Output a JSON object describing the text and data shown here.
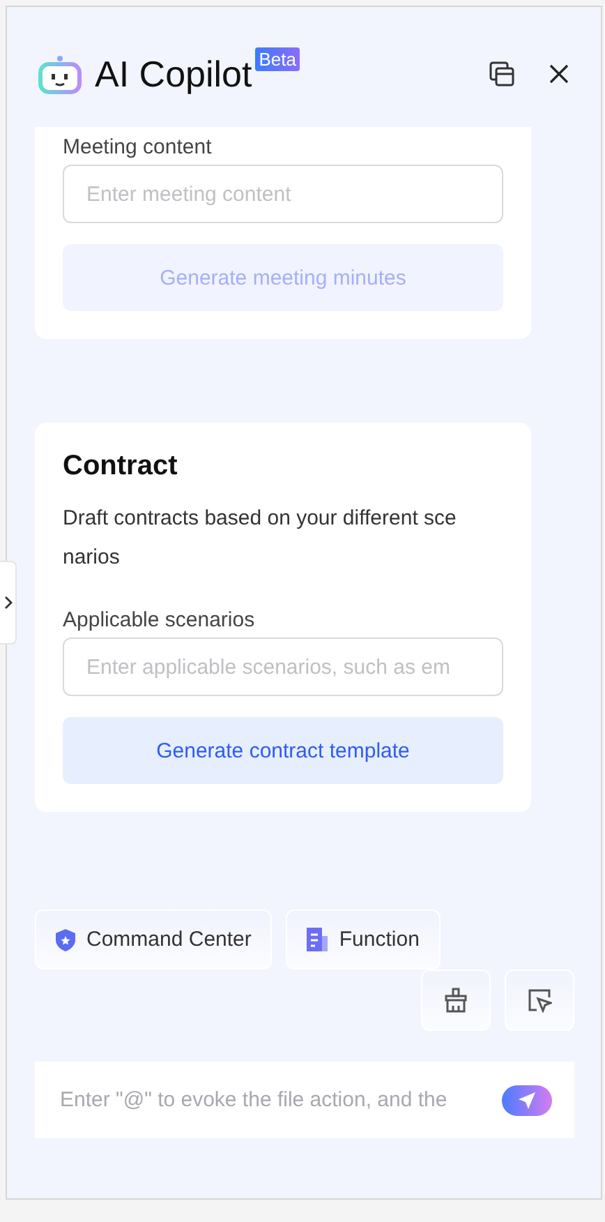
{
  "header": {
    "title": "AI Copilot",
    "badge": "Beta"
  },
  "cards": [
    {
      "field_label": "Meeting content",
      "placeholder": "Enter meeting content",
      "button": {
        "label": "Generate meeting minutes",
        "disabled": true
      }
    },
    {
      "title": "Contract",
      "description": "Draft contracts based on your different scenarios",
      "field_label": "Applicable scenarios",
      "placeholder": "Enter applicable scenarios, such as em",
      "button": {
        "label": "Generate contract template",
        "disabled": false
      }
    }
  ],
  "chips": [
    {
      "kind": "shield",
      "label": "Command Center"
    },
    {
      "kind": "document",
      "label": "Function"
    }
  ],
  "composer": {
    "placeholder": "Enter \"@\" to evoke the file action, and the"
  }
}
